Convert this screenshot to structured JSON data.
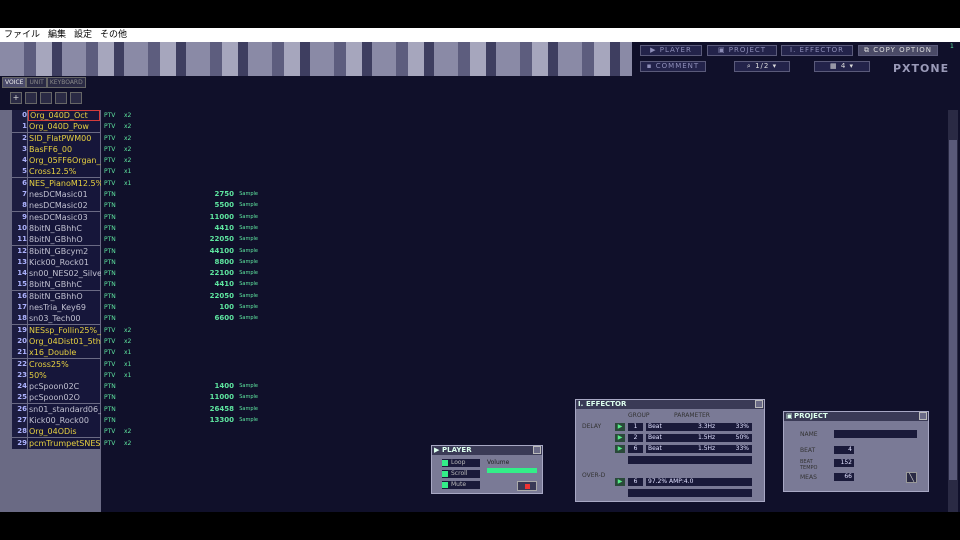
{
  "menu": [
    "ファイル",
    "編集",
    "設定",
    "その他"
  ],
  "toolbar": {
    "player": "PLAYER",
    "project": "PROJECT",
    "effector": "EFFECTOR",
    "copy_option": "COPY OPTION",
    "comment": "COMMENT",
    "page": "1/2",
    "division": "4",
    "badge": "1"
  },
  "logo": "PXTONE",
  "tabs": [
    "VOICE",
    "UNIT",
    "KEYBOARD"
  ],
  "add_button": "+",
  "units": [
    {
      "num": "0",
      "name": "Org_040D_Oct",
      "type": "PTV",
      "ch": "x2"
    },
    {
      "num": "1",
      "name": "Org_040D_Pow",
      "type": "PTV",
      "ch": "x2"
    },
    {
      "num": "2",
      "name": "SID_FlatPWM00",
      "type": "PTV",
      "ch": "x2"
    },
    {
      "num": "3",
      "name": "BasFF6_00",
      "type": "PTV",
      "ch": "x2"
    },
    {
      "num": "4",
      "name": "Org_05FF6Organ_N",
      "type": "PTV",
      "ch": "x2"
    },
    {
      "num": "5",
      "name": "Cross12.5%",
      "type": "PTV",
      "ch": "x1"
    },
    {
      "num": "6",
      "name": "NES_PianoM12.5%",
      "type": "PTV",
      "ch": "x1"
    },
    {
      "num": "7",
      "name": "nesDCMasic01",
      "type": "PTN",
      "sample": "2750"
    },
    {
      "num": "8",
      "name": "nesDCMasic02",
      "type": "PTN",
      "sample": "5500"
    },
    {
      "num": "9",
      "name": "nesDCMasic03",
      "type": "PTN",
      "sample": "11000"
    },
    {
      "num": "10",
      "name": "8bitN_GBhhC",
      "type": "PTN",
      "sample": "4410"
    },
    {
      "num": "11",
      "name": "8bitN_GBhhO",
      "type": "PTN",
      "sample": "22050"
    },
    {
      "num": "12",
      "name": "8bitN_GBcym2",
      "type": "PTN",
      "sample": "44100"
    },
    {
      "num": "13",
      "name": "Kick00_Rock01",
      "type": "PTN",
      "sample": "8800"
    },
    {
      "num": "14",
      "name": "sn00_NES02_Silve",
      "type": "PTN",
      "sample": "22100"
    },
    {
      "num": "15",
      "name": "8bitN_GBhhC",
      "type": "PTN",
      "sample": "4410"
    },
    {
      "num": "16",
      "name": "8bitN_GBhhO",
      "type": "PTN",
      "sample": "22050"
    },
    {
      "num": "17",
      "name": "nesTria_Key69",
      "type": "PTN",
      "sample": "100"
    },
    {
      "num": "18",
      "name": "sn03_Tech00",
      "type": "PTN",
      "sample": "6600"
    },
    {
      "num": "19",
      "name": "NESsp_Follin25%_",
      "type": "PTV",
      "ch": "x2"
    },
    {
      "num": "20",
      "name": "Org_04Dist01_5th",
      "type": "PTV",
      "ch": "x2"
    },
    {
      "num": "21",
      "name": "x16_Double",
      "type": "PTV",
      "ch": "x1"
    },
    {
      "num": "22",
      "name": "Cross25%",
      "type": "PTV",
      "ch": "x1"
    },
    {
      "num": "23",
      "name": "50%",
      "type": "PTV",
      "ch": "x1"
    },
    {
      "num": "24",
      "name": "pcSpoon02C",
      "type": "PTN",
      "sample": "1400"
    },
    {
      "num": "25",
      "name": "pcSpoon02O",
      "type": "PTN",
      "sample": "11000"
    },
    {
      "num": "26",
      "name": "sn01_standard06_",
      "type": "PTN",
      "sample": "26458"
    },
    {
      "num": "27",
      "name": "Kick00_Rock00",
      "type": "PTN",
      "sample": "13300"
    },
    {
      "num": "28",
      "name": "Org_04ODis",
      "type": "PTV",
      "ch": "x2"
    },
    {
      "num": "29",
      "name": "pcmTrumpetSNES01",
      "type": "PTV",
      "ch": "x2"
    }
  ],
  "sample_unit": "Sample",
  "player": {
    "title": "PLAYER",
    "loop": "Loop",
    "scroll": "Scroll",
    "mute": "Mute",
    "volume": "Volume"
  },
  "effector": {
    "title": "EFFECTOR",
    "group": "GROUP",
    "parameter": "PARAMETER",
    "delay": "DELAY",
    "overdrive": "OVER-D",
    "delays": [
      {
        "group": "1",
        "unit": "Beat",
        "freq": "3.3Hz",
        "rate": "33%"
      },
      {
        "group": "2",
        "unit": "Beat",
        "freq": "1.5Hz",
        "rate": "50%"
      },
      {
        "group": "6",
        "unit": "Beat",
        "freq": "1.5Hz",
        "rate": "33%"
      }
    ],
    "overdrive_row": {
      "group": "6",
      "value": "97.2%",
      "amp": "AMP:4.0"
    }
  },
  "project": {
    "title": "PROJECT",
    "name_label": "NAME",
    "beat_label": "BEAT",
    "beat": "4",
    "tempo_label": "BEAT TEMPO",
    "tempo": "152",
    "meas_label": "MEAS",
    "meas": "66"
  }
}
